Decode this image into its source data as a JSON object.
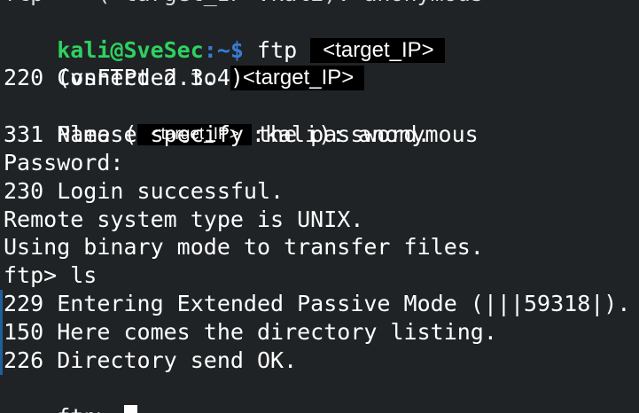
{
  "terminal": {
    "previous_line_fragment": "ftp    (<target_IP>:kali): anonymous",
    "prompt": {
      "user_host": "kali@SveSec",
      "path_marker": ":~$",
      "command": "ftp "
    },
    "redacted_target": "<target_IP>",
    "connected_prefix": "Connected to ",
    "lines": {
      "banner": "220 (vsFTPd 2.3.4)",
      "name_prefix": "Name (",
      "name_suffix": ":kali): anonymous",
      "password_prompt_reply": "331 Please specify the password.",
      "password_label": "Password:",
      "login_success": "230 Login successful.",
      "system_type": "Remote system type is UNIX.",
      "binary_mode": "Using binary mode to transfer files.",
      "ls_command": "ftp> ls",
      "passive_mode": "229 Entering Extended Passive Mode (|||59318|).",
      "directory_listing": "150 Here comes the directory listing.",
      "directory_ok": "226 Directory send OK.",
      "final_prompt": "ftp> "
    },
    "colors": {
      "background": "#1f2326",
      "text": "#ffffff",
      "user_host": "#2fd15f",
      "path": "#3a7bd5",
      "redaction_background": "#000000",
      "marker": "#1f5f9a"
    },
    "cursor_icon": "block-cursor-icon"
  }
}
